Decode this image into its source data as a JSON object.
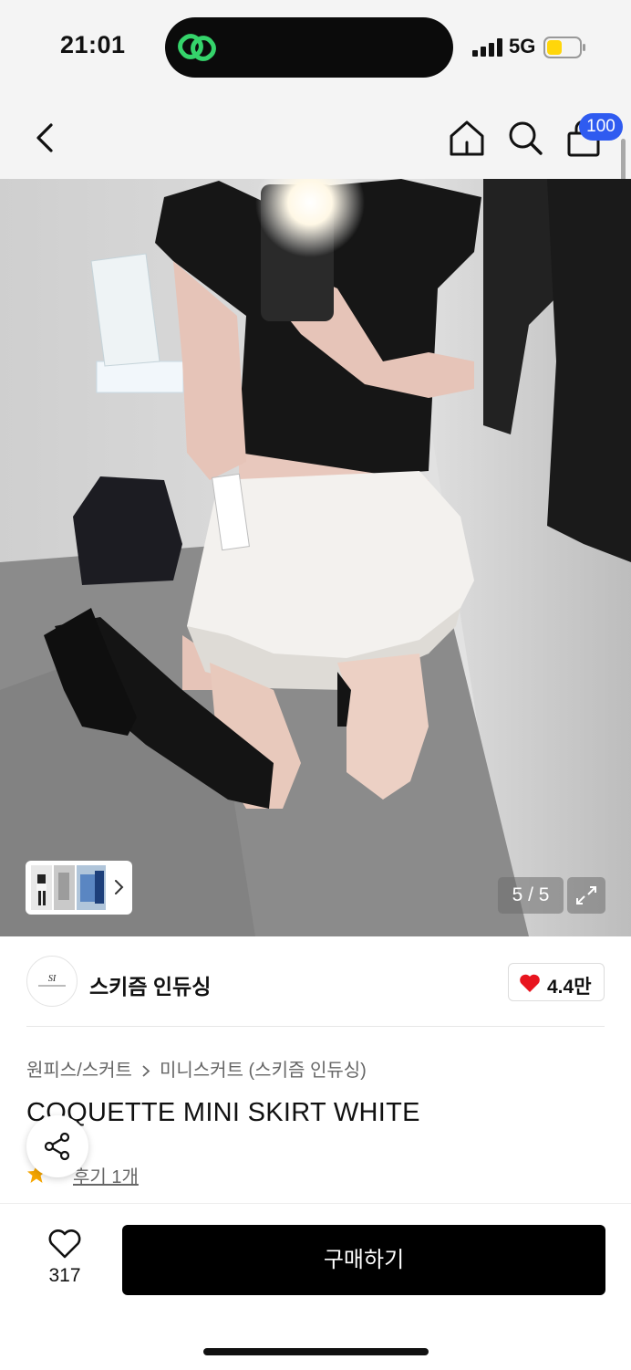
{
  "status_bar": {
    "time": "21:01",
    "network": "5G",
    "island_icon": "link-icon",
    "battery_color": "#ffd60a"
  },
  "header": {
    "icons": [
      "back-arrow-icon",
      "home-icon",
      "search-icon",
      "shopping-bag-icon"
    ],
    "cart_badge": "100",
    "badge_color": "#2f5bf0"
  },
  "gallery": {
    "counter": "5 / 5",
    "thumbnails_icon": "chevron-right-icon",
    "expand_icon": "expand-icon"
  },
  "store": {
    "name": "스키즘 인듀싱",
    "logo_icon": "store-logo",
    "likes": "4.4만",
    "heart_color": "#e8141e"
  },
  "product": {
    "breadcrumb": [
      "원피스/스커트",
      "미니스커트 (스키즘 인듀싱)"
    ],
    "title": "COQUETTE MINI SKIRT WHITE",
    "review_link": "후기 1개",
    "star_color": "#f6a600"
  },
  "actions": {
    "share_icon": "share-icon",
    "wish_count": "317",
    "buy_label": "구매하기"
  }
}
